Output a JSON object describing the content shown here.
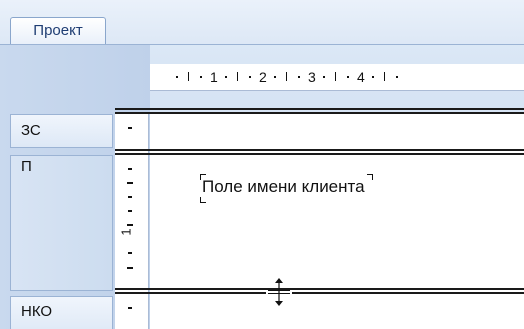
{
  "tabs": [
    {
      "label": "Проект",
      "active": true
    }
  ],
  "ruler": {
    "numbers": [
      "1",
      "2",
      "3",
      "4"
    ]
  },
  "sections": [
    {
      "id": "zs",
      "label": "ЗС"
    },
    {
      "id": "p",
      "label": "П"
    },
    {
      "id": "nko",
      "label": "НКО"
    }
  ],
  "fields": [
    {
      "label": "Поле имени клиента"
    }
  ],
  "vertical_ruler": {
    "number": "1"
  },
  "icons": {
    "resize_handle": "row-resize-icon"
  },
  "colors": {
    "accent": "#1f3d73",
    "panel": "#c9d9ee",
    "border": "#9bb3d4"
  }
}
